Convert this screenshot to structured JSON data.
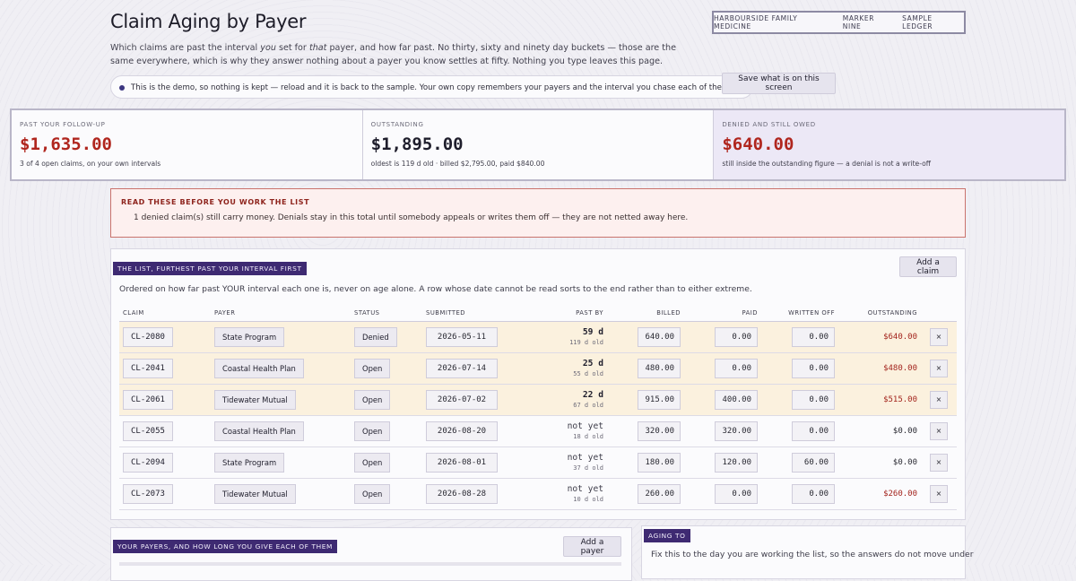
{
  "header": {
    "title": "Claim Aging by Payer",
    "org": [
      "HARBOURSIDE FAMILY MEDICINE",
      "MARKER NINE",
      "SAMPLE LEDGER"
    ],
    "intro_parts": [
      "Which claims are past the interval ",
      "you",
      " set for ",
      "that",
      " payer, and how far past. No thirty, sixty and ninety day buckets — those are the same everywhere, which is why they answer nothing about a payer you know settles at fifty. Nothing you type leaves this page."
    ],
    "notice": "This is the demo, so nothing is kept — reload and it is back to the sample. Your own copy remembers your payers and the interval you chase each of them on.",
    "save_label": "Save what is on this screen"
  },
  "summary": [
    {
      "label": "PAST YOUR FOLLOW-UP",
      "value": "$1,635.00",
      "note": "3 of 4 open claims, on your own intervals",
      "color": "#b0261e"
    },
    {
      "label": "OUTSTANDING",
      "value": "$1,895.00",
      "note": "oldest is 119 d old · billed $2,795.00, paid $840.00",
      "color": "#1f1e2c"
    },
    {
      "label": "DENIED AND STILL OWED",
      "value": "$640.00",
      "note": "still inside the outstanding figure — a denial is not a write-off",
      "color": "#b0261e"
    }
  ],
  "warning": {
    "title": "READ THESE BEFORE YOU WORK THE LIST",
    "text": "1 denied claim(s) still carry money. Denials stay in this total until somebody appeals or writes them off — they are not netted away here."
  },
  "list": {
    "tag": "THE LIST, FURTHEST PAST YOUR INTERVAL FIRST",
    "add_label": "Add a claim",
    "description": "Ordered on how far past YOUR interval each one is, never on age alone. A row whose date cannot be read sorts to the end rather than to either extreme.",
    "columns": [
      "CLAIM",
      "PAYER",
      "STATUS",
      "SUBMITTED",
      "PAST BY",
      "BILLED",
      "PAID",
      "WRITTEN OFF",
      "OUTSTANDING"
    ],
    "rows": [
      {
        "claim": "CL-2080",
        "payer": "State Program",
        "status": "Denied",
        "submitted": "2026-05-11",
        "past": "59 d",
        "age": "119 d old",
        "billed": "640.00",
        "paid": "0.00",
        "written_off": "0.00",
        "outstanding": "$640.00",
        "late": true,
        "owed": true
      },
      {
        "claim": "CL-2041",
        "payer": "Coastal Health Plan",
        "status": "Open",
        "submitted": "2026-07-14",
        "past": "25 d",
        "age": "55 d old",
        "billed": "480.00",
        "paid": "0.00",
        "written_off": "0.00",
        "outstanding": "$480.00",
        "late": true,
        "owed": true
      },
      {
        "claim": "CL-2061",
        "payer": "Tidewater Mutual",
        "status": "Open",
        "submitted": "2026-07-02",
        "past": "22 d",
        "age": "67 d old",
        "billed": "915.00",
        "paid": "400.00",
        "written_off": "0.00",
        "outstanding": "$515.00",
        "late": true,
        "owed": true
      },
      {
        "claim": "CL-2055",
        "payer": "Coastal Health Plan",
        "status": "Open",
        "submitted": "2026-08-20",
        "past": "not yet",
        "age": "18 d old",
        "billed": "320.00",
        "paid": "320.00",
        "written_off": "0.00",
        "outstanding": "$0.00",
        "late": false,
        "owed": false
      },
      {
        "claim": "CL-2094",
        "payer": "State Program",
        "status": "Open",
        "submitted": "2026-08-01",
        "past": "not yet",
        "age": "37 d old",
        "billed": "180.00",
        "paid": "120.00",
        "written_off": "60.00",
        "outstanding": "$0.00",
        "late": false,
        "owed": false
      },
      {
        "claim": "CL-2073",
        "payer": "Tidewater Mutual",
        "status": "Open",
        "submitted": "2026-08-28",
        "past": "not yet",
        "age": "10 d old",
        "billed": "260.00",
        "paid": "0.00",
        "written_off": "0.00",
        "outstanding": "$260.00",
        "late": false,
        "owed": true
      }
    ],
    "remove_label": "×"
  },
  "payers": {
    "tag": "YOUR PAYERS, AND HOW LONG YOU GIVE EACH OF THEM",
    "add_label": "Add a payer"
  },
  "aging": {
    "tag": "AGING TO",
    "text": "Fix this to the day you are working the list, so the answers do not move under"
  }
}
